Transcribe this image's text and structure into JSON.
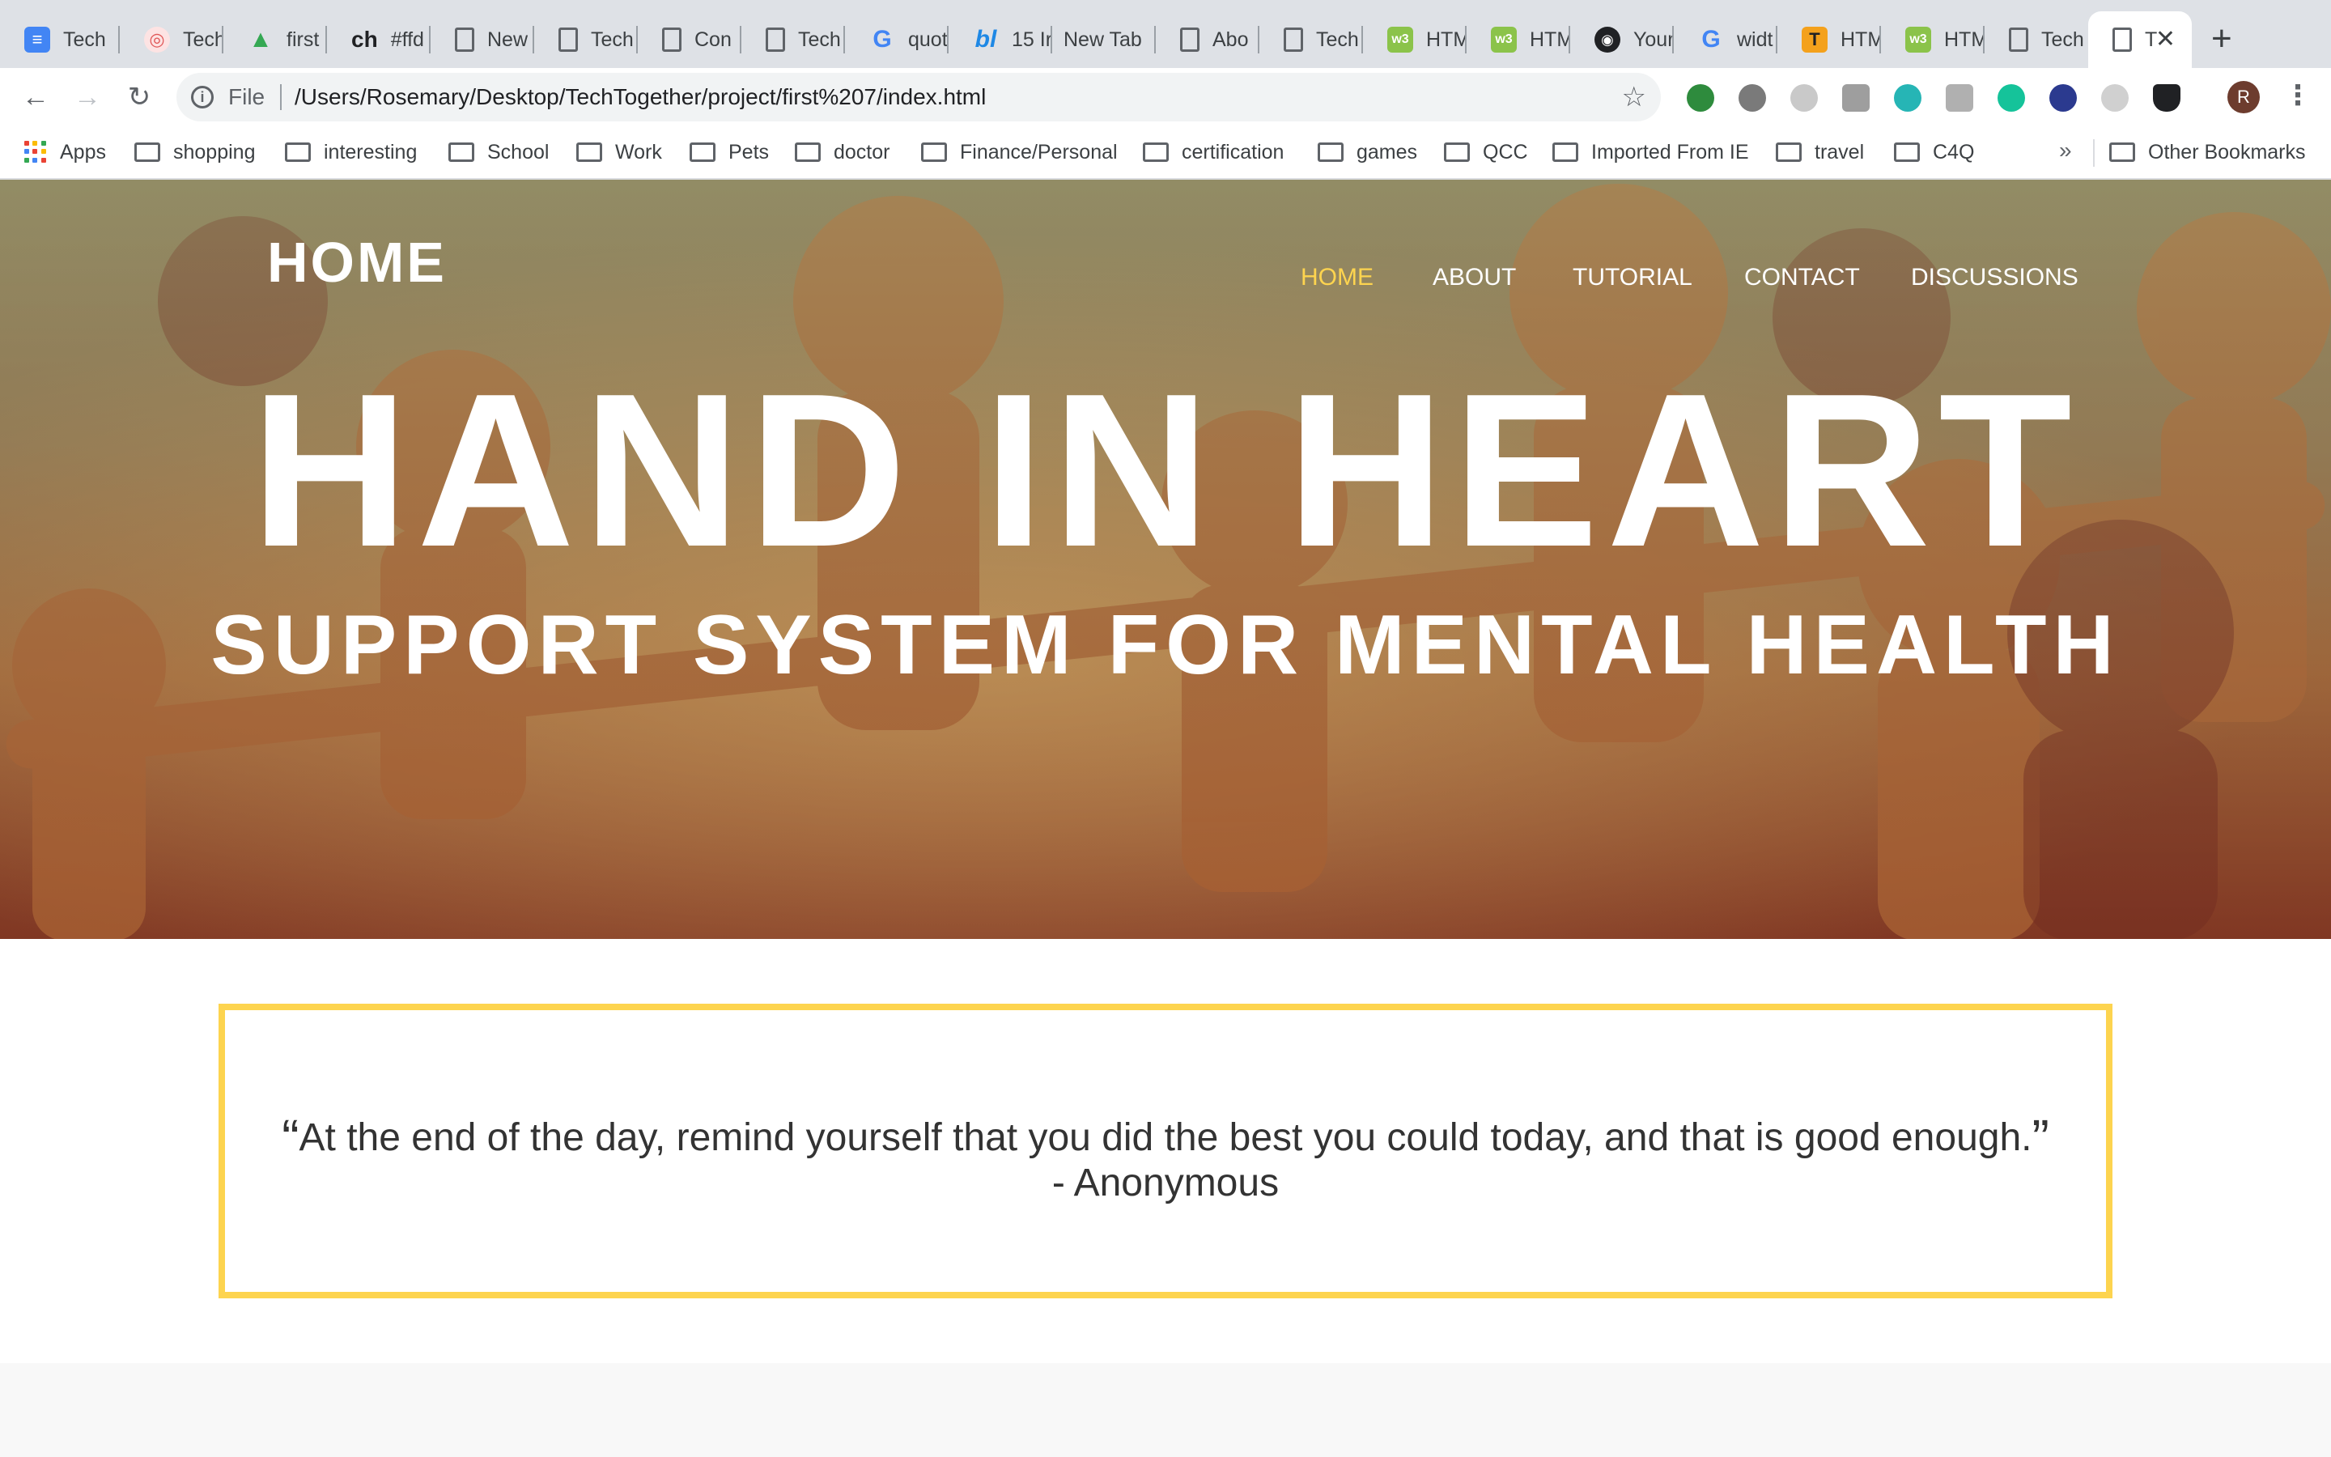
{
  "browser": {
    "tabs": [
      {
        "title": "Tech",
        "favicon": "docs-icon",
        "color": "#4285f4"
      },
      {
        "title": "Tech",
        "favicon": "target-icon",
        "color": "#e05757"
      },
      {
        "title": "first",
        "favicon": "drive-icon",
        "color": "#34a853"
      },
      {
        "title": "#ffd",
        "favicon": "ch-icon",
        "color": "#202124"
      },
      {
        "title": "New",
        "favicon": "page-icon",
        "color": "#5f6368"
      },
      {
        "title": "Tech",
        "favicon": "page-icon",
        "color": "#5f6368"
      },
      {
        "title": "Con",
        "favicon": "page-icon",
        "color": "#5f6368"
      },
      {
        "title": "Tech",
        "favicon": "page-icon",
        "color": "#5f6368"
      },
      {
        "title": "quot",
        "favicon": "google-icon",
        "color": "#4285f4"
      },
      {
        "title": "15 Ir",
        "favicon": "bl-icon",
        "color": "#1e88e5"
      },
      {
        "title": "New Tab",
        "favicon": "",
        "color": ""
      },
      {
        "title": "Abo",
        "favicon": "page-icon",
        "color": "#5f6368"
      },
      {
        "title": "Tech",
        "favicon": "page-icon",
        "color": "#5f6368"
      },
      {
        "title": "HTM",
        "favicon": "w3-icon",
        "color": "#8bc34a"
      },
      {
        "title": "HTM",
        "favicon": "w3-icon",
        "color": "#8bc34a"
      },
      {
        "title": "Your",
        "favicon": "github-icon",
        "color": "#202124"
      },
      {
        "title": "widt",
        "favicon": "google-icon",
        "color": "#4285f4"
      },
      {
        "title": "HTM",
        "favicon": "t-icon",
        "color": "#f4a11c"
      },
      {
        "title": "HTM",
        "favicon": "w3-icon",
        "color": "#8bc34a"
      },
      {
        "title": "Tech",
        "favicon": "page-icon",
        "color": "#5f6368"
      },
      {
        "title": "T",
        "favicon": "page-icon",
        "color": "#5f6368",
        "active": true
      }
    ],
    "address": {
      "scheme": "File",
      "url": "/Users/Rosemary/Desktop/TechTogether/project/first%207/index.html"
    },
    "profile_initial": "R",
    "bookmarks": [
      "Apps",
      "shopping",
      "interesting",
      "School",
      "Work",
      "Pets",
      "doctor",
      "Finance/Personal",
      "certification",
      "games",
      "QCC",
      "Imported From IE",
      "travel",
      "C4Q"
    ],
    "bookmarks_overflow": "»",
    "other_bookmarks": "Other Bookmarks"
  },
  "site": {
    "logo": "HOME",
    "nav": [
      "HOME",
      "ABOUT",
      "TUTORIAL",
      "CONTACT",
      "DISCUSSIONS"
    ],
    "active_nav": "HOME",
    "hero_title": "HAND IN HEART",
    "hero_subtitle": "SUPPORT SYSTEM FOR MENTAL HEALTH",
    "quote": {
      "open_mark": "“",
      "text": "At the end of the day, remind yourself that you did the best you could today, and that is good enough.",
      "close_mark": "”",
      "attribution": "- Anonymous"
    },
    "colors": {
      "accent": "#fdd44f",
      "hero_top": "#958f68",
      "hero_bottom": "#8c3e27",
      "paper_figure": "#c67a3e"
    }
  }
}
